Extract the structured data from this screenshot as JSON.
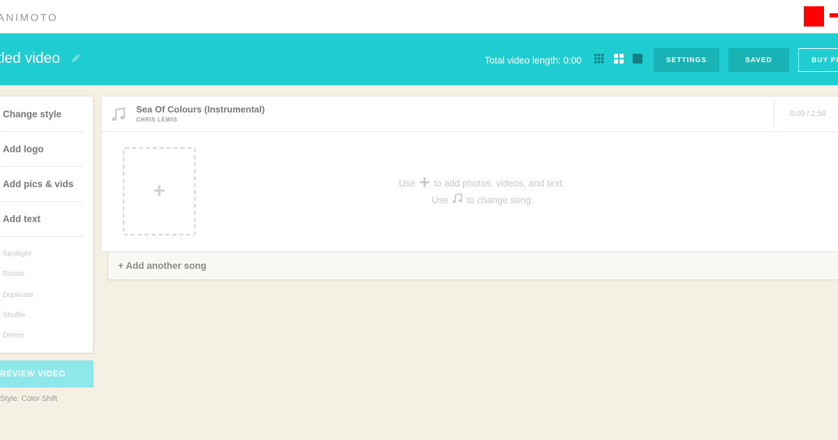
{
  "topbar": {
    "logo": "ANIMOTO"
  },
  "header": {
    "title": "tled video",
    "total_length": "Total video length: 0:00",
    "buttons": {
      "settings": "SETTINGS",
      "saved": "SAVED",
      "buy": "BUY PI"
    }
  },
  "sidebar": {
    "main_items": [
      "Change style",
      "Add logo",
      "Add pics & vids",
      "Add text"
    ],
    "sub_items": [
      "Spotlight",
      "Rotate",
      "Duplicate",
      "Shuffle",
      "Delete"
    ],
    "preview_label": "REVIEW VIDEO",
    "style_label": "Style: Color Shift"
  },
  "song": {
    "title": "Sea Of Colours (Instrumental)",
    "artist": "CHRIS LEWIS",
    "time": "0:00 / 2:58"
  },
  "hints": {
    "line1_pre": "Use",
    "line1_post": "to add photos, videos, and text.",
    "line2_pre": "Use",
    "line2_post": "to change song."
  },
  "add_song": "+ Add another song",
  "colors": {
    "brand_teal": "#1fcdd0",
    "button_teal": "#19b3b6",
    "preview_teal": "#8ee8ea",
    "background": "#f5f0e4"
  },
  "icons": [
    "pencil-icon",
    "grid-small-view-icon",
    "grid-medium-view-icon",
    "grid-large-view-icon",
    "music-note-icon",
    "plus-icon"
  ]
}
